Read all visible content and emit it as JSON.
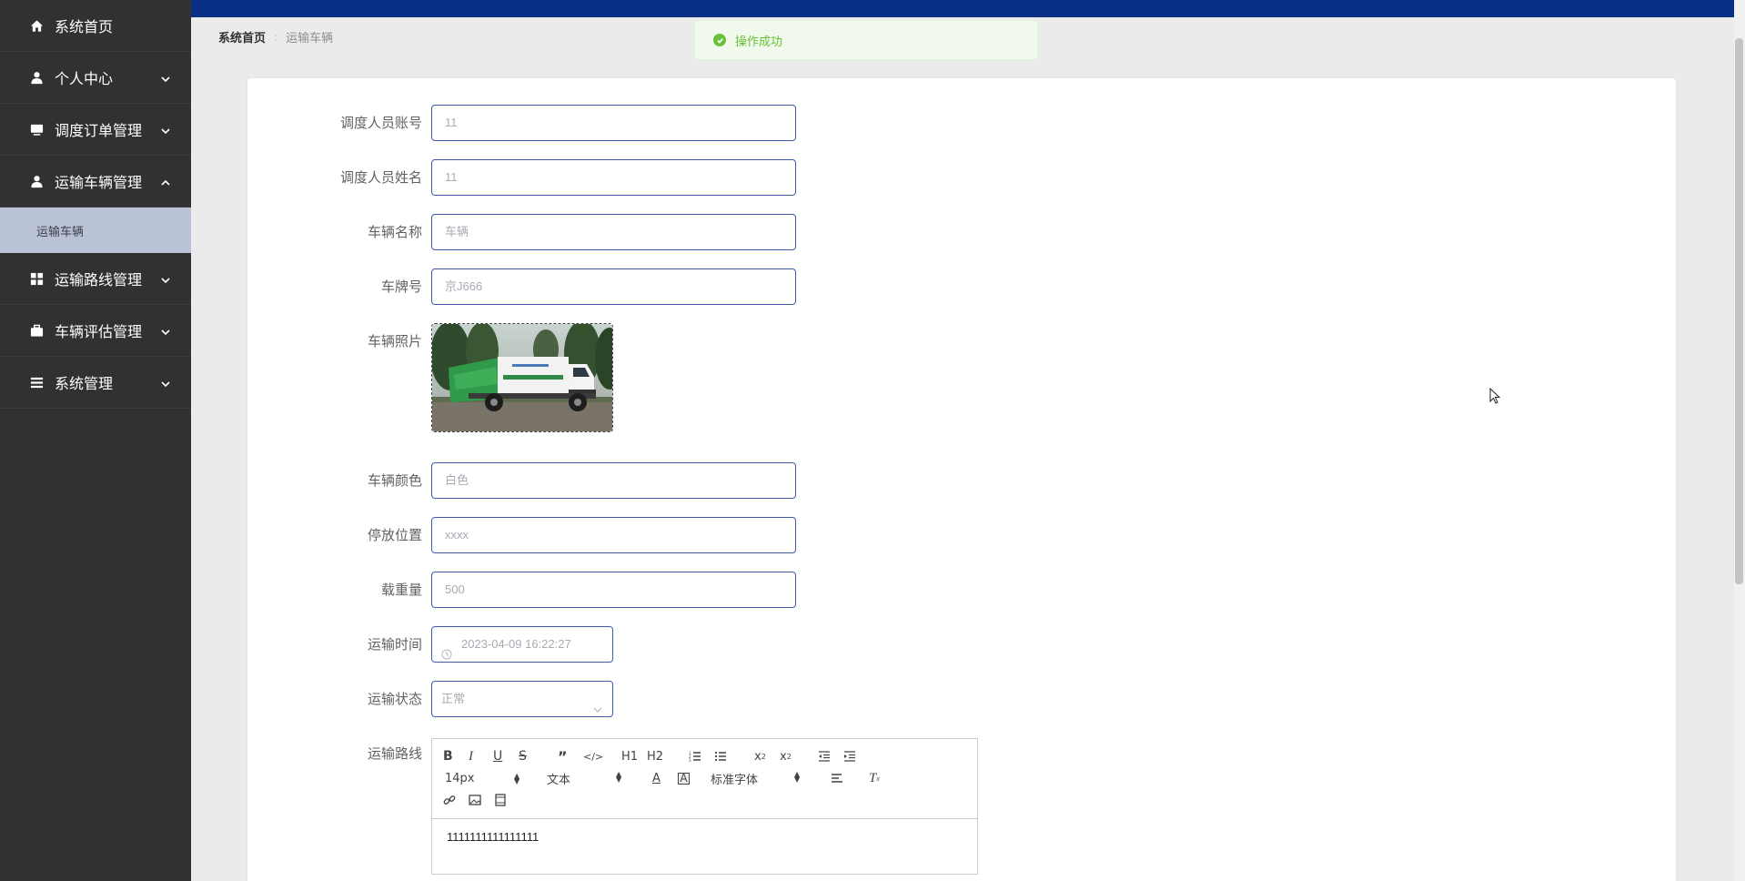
{
  "sidebar": {
    "items": [
      {
        "label": "系统首页",
        "icon": "home-icon",
        "expandable": false
      },
      {
        "label": "个人中心",
        "icon": "user-icon",
        "expandable": true
      },
      {
        "label": "调度订单管理",
        "icon": "monitor-icon",
        "expandable": true
      },
      {
        "label": "运输车辆管理",
        "icon": "user-icon",
        "expandable": true,
        "expanded": true
      },
      {
        "label": "运输路线管理",
        "icon": "grid-icon",
        "expandable": true
      },
      {
        "label": "车辆评估管理",
        "icon": "briefcase-icon",
        "expandable": true
      },
      {
        "label": "系统管理",
        "icon": "list-icon",
        "expandable": true
      }
    ],
    "active_sub_item": "运输车辆"
  },
  "breadcrumb": {
    "home": "系统首页",
    "separator": ":",
    "current": "运输车辆"
  },
  "toast": {
    "message": "操作成功",
    "type": "success",
    "color": "#67c23a"
  },
  "form": {
    "dispatcher_account": {
      "label": "调度人员账号",
      "value": "11"
    },
    "dispatcher_name": {
      "label": "调度人员姓名",
      "value": "11"
    },
    "vehicle_name": {
      "label": "车辆名称",
      "value": "车辆"
    },
    "plate_number": {
      "label": "车牌号",
      "value": "京J666"
    },
    "vehicle_photo": {
      "label": "车辆照片"
    },
    "vehicle_color": {
      "label": "车辆颜色",
      "value": "白色"
    },
    "parking_location": {
      "label": "停放位置",
      "value": "xxxx"
    },
    "load_capacity": {
      "label": "载重量",
      "value": "500"
    },
    "transport_time": {
      "label": "运输时间",
      "value": "2023-04-09 16:22:27"
    },
    "transport_status": {
      "label": "运输状态",
      "value": "正常"
    },
    "transport_route": {
      "label": "运输路线",
      "content": "1111111111111111"
    }
  },
  "editor": {
    "font_size": "14px",
    "block_format": "文本",
    "font_family": "标准字体",
    "h1": "H1",
    "h2": "H2"
  },
  "colors": {
    "sidebar_bg": "#313131",
    "topbar_bg": "#0a2f86",
    "active_sub_bg": "#b9c2d6",
    "input_border": "#3f5ba8"
  }
}
